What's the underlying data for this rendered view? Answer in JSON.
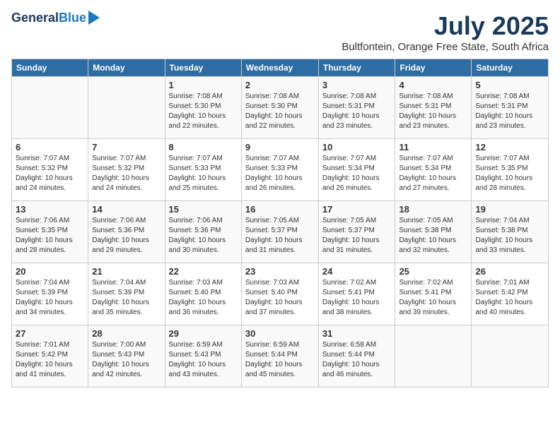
{
  "header": {
    "logo_line1": "General",
    "logo_line2": "Blue",
    "month_year": "July 2025",
    "location": "Bultfontein, Orange Free State, South Africa"
  },
  "weekdays": [
    "Sunday",
    "Monday",
    "Tuesday",
    "Wednesday",
    "Thursday",
    "Friday",
    "Saturday"
  ],
  "weeks": [
    [
      {
        "day": "",
        "detail": ""
      },
      {
        "day": "",
        "detail": ""
      },
      {
        "day": "1",
        "detail": "Sunrise: 7:08 AM\nSunset: 5:30 PM\nDaylight: 10 hours\nand 22 minutes."
      },
      {
        "day": "2",
        "detail": "Sunrise: 7:08 AM\nSunset: 5:30 PM\nDaylight: 10 hours\nand 22 minutes."
      },
      {
        "day": "3",
        "detail": "Sunrise: 7:08 AM\nSunset: 5:31 PM\nDaylight: 10 hours\nand 23 minutes."
      },
      {
        "day": "4",
        "detail": "Sunrise: 7:08 AM\nSunset: 5:31 PM\nDaylight: 10 hours\nand 23 minutes."
      },
      {
        "day": "5",
        "detail": "Sunrise: 7:08 AM\nSunset: 5:31 PM\nDaylight: 10 hours\nand 23 minutes."
      }
    ],
    [
      {
        "day": "6",
        "detail": "Sunrise: 7:07 AM\nSunset: 5:32 PM\nDaylight: 10 hours\nand 24 minutes."
      },
      {
        "day": "7",
        "detail": "Sunrise: 7:07 AM\nSunset: 5:32 PM\nDaylight: 10 hours\nand 24 minutes."
      },
      {
        "day": "8",
        "detail": "Sunrise: 7:07 AM\nSunset: 5:33 PM\nDaylight: 10 hours\nand 25 minutes."
      },
      {
        "day": "9",
        "detail": "Sunrise: 7:07 AM\nSunset: 5:33 PM\nDaylight: 10 hours\nand 26 minutes."
      },
      {
        "day": "10",
        "detail": "Sunrise: 7:07 AM\nSunset: 5:34 PM\nDaylight: 10 hours\nand 26 minutes."
      },
      {
        "day": "11",
        "detail": "Sunrise: 7:07 AM\nSunset: 5:34 PM\nDaylight: 10 hours\nand 27 minutes."
      },
      {
        "day": "12",
        "detail": "Sunrise: 7:07 AM\nSunset: 5:35 PM\nDaylight: 10 hours\nand 28 minutes."
      }
    ],
    [
      {
        "day": "13",
        "detail": "Sunrise: 7:06 AM\nSunset: 5:35 PM\nDaylight: 10 hours\nand 28 minutes."
      },
      {
        "day": "14",
        "detail": "Sunrise: 7:06 AM\nSunset: 5:36 PM\nDaylight: 10 hours\nand 29 minutes."
      },
      {
        "day": "15",
        "detail": "Sunrise: 7:06 AM\nSunset: 5:36 PM\nDaylight: 10 hours\nand 30 minutes."
      },
      {
        "day": "16",
        "detail": "Sunrise: 7:05 AM\nSunset: 5:37 PM\nDaylight: 10 hours\nand 31 minutes."
      },
      {
        "day": "17",
        "detail": "Sunrise: 7:05 AM\nSunset: 5:37 PM\nDaylight: 10 hours\nand 31 minutes."
      },
      {
        "day": "18",
        "detail": "Sunrise: 7:05 AM\nSunset: 5:38 PM\nDaylight: 10 hours\nand 32 minutes."
      },
      {
        "day": "19",
        "detail": "Sunrise: 7:04 AM\nSunset: 5:38 PM\nDaylight: 10 hours\nand 33 minutes."
      }
    ],
    [
      {
        "day": "20",
        "detail": "Sunrise: 7:04 AM\nSunset: 5:39 PM\nDaylight: 10 hours\nand 34 minutes."
      },
      {
        "day": "21",
        "detail": "Sunrise: 7:04 AM\nSunset: 5:39 PM\nDaylight: 10 hours\nand 35 minutes."
      },
      {
        "day": "22",
        "detail": "Sunrise: 7:03 AM\nSunset: 5:40 PM\nDaylight: 10 hours\nand 36 minutes."
      },
      {
        "day": "23",
        "detail": "Sunrise: 7:03 AM\nSunset: 5:40 PM\nDaylight: 10 hours\nand 37 minutes."
      },
      {
        "day": "24",
        "detail": "Sunrise: 7:02 AM\nSunset: 5:41 PM\nDaylight: 10 hours\nand 38 minutes."
      },
      {
        "day": "25",
        "detail": "Sunrise: 7:02 AM\nSunset: 5:41 PM\nDaylight: 10 hours\nand 39 minutes."
      },
      {
        "day": "26",
        "detail": "Sunrise: 7:01 AM\nSunset: 5:42 PM\nDaylight: 10 hours\nand 40 minutes."
      }
    ],
    [
      {
        "day": "27",
        "detail": "Sunrise: 7:01 AM\nSunset: 5:42 PM\nDaylight: 10 hours\nand 41 minutes."
      },
      {
        "day": "28",
        "detail": "Sunrise: 7:00 AM\nSunset: 5:43 PM\nDaylight: 10 hours\nand 42 minutes."
      },
      {
        "day": "29",
        "detail": "Sunrise: 6:59 AM\nSunset: 5:43 PM\nDaylight: 10 hours\nand 43 minutes."
      },
      {
        "day": "30",
        "detail": "Sunrise: 6:59 AM\nSunset: 5:44 PM\nDaylight: 10 hours\nand 45 minutes."
      },
      {
        "day": "31",
        "detail": "Sunrise: 6:58 AM\nSunset: 5:44 PM\nDaylight: 10 hours\nand 46 minutes."
      },
      {
        "day": "",
        "detail": ""
      },
      {
        "day": "",
        "detail": ""
      }
    ]
  ]
}
